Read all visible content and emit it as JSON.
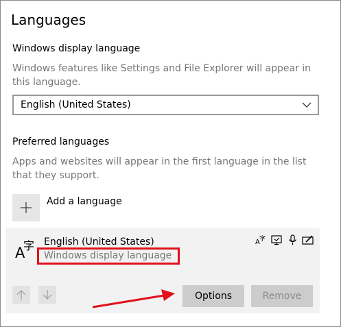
{
  "page": {
    "title": "Languages"
  },
  "display_language": {
    "label": "Windows display language",
    "description": "Windows features like Settings and File Explorer will appear in this language.",
    "selected_value": "English (United States)"
  },
  "preferred": {
    "label": "Preferred languages",
    "description": "Apps and websites will appear in the first language in the list that they support.",
    "add_label": "Add a language"
  },
  "language_item": {
    "name": "English (United States)",
    "sub": "Windows display language",
    "features": [
      "language-pack-icon",
      "display-icon",
      "microphone-icon",
      "handwriting-icon"
    ]
  },
  "actions": {
    "options_label": "Options",
    "remove_label": "Remove"
  },
  "colors": {
    "highlight": "#e0101b",
    "panel": "#f2f2f2",
    "button": "#cccccc"
  }
}
